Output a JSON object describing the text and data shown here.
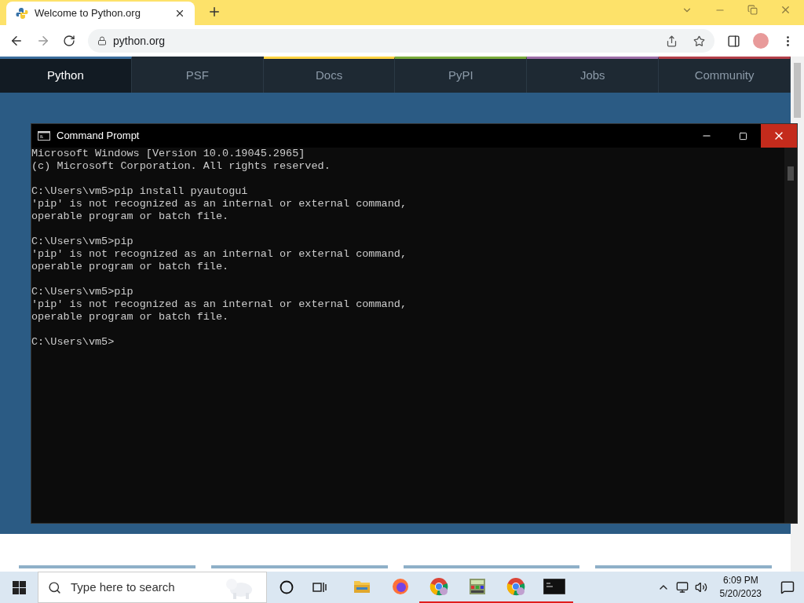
{
  "browser": {
    "tab_title": "Welcome to Python.org",
    "address": "python.org"
  },
  "site_nav": [
    {
      "label": "Python",
      "selected": true,
      "color": "#3b6d9c"
    },
    {
      "label": "PSF",
      "selected": false,
      "color": "#1e2933"
    },
    {
      "label": "Docs",
      "selected": false,
      "color": "#ffd343"
    },
    {
      "label": "PyPI",
      "selected": false,
      "color": "#7aac3c"
    },
    {
      "label": "Jobs",
      "selected": false,
      "color": "#9e6fa8"
    },
    {
      "label": "Community",
      "selected": false,
      "color": "#b3404a"
    }
  ],
  "console": {
    "title": "Command Prompt",
    "blocks": [
      [
        "Microsoft Windows [Version 10.0.19045.2965]",
        "(c) Microsoft Corporation. All rights reserved."
      ],
      [
        "C:\\Users\\vm5>pip install pyautogui",
        "'pip' is not recognized as an internal or external command,",
        "operable program or batch file."
      ],
      [
        "C:\\Users\\vm5>pip",
        "'pip' is not recognized as an internal or external command,",
        "operable program or batch file."
      ],
      [
        "C:\\Users\\vm5>pip",
        "'pip' is not recognized as an internal or external command,",
        "operable program or batch file."
      ],
      [
        "C:\\Users\\vm5>"
      ]
    ]
  },
  "taskbar": {
    "search_placeholder": "Type here to search",
    "apps": [
      {
        "kind": "explorer",
        "running": false
      },
      {
        "kind": "firefox",
        "running": false
      },
      {
        "kind": "chrome",
        "running": true
      },
      {
        "kind": "calculator",
        "running": true
      },
      {
        "kind": "chrome",
        "running": true
      },
      {
        "kind": "terminal",
        "running": true
      }
    ],
    "time": "6:09 PM",
    "date": "5/20/2023"
  }
}
